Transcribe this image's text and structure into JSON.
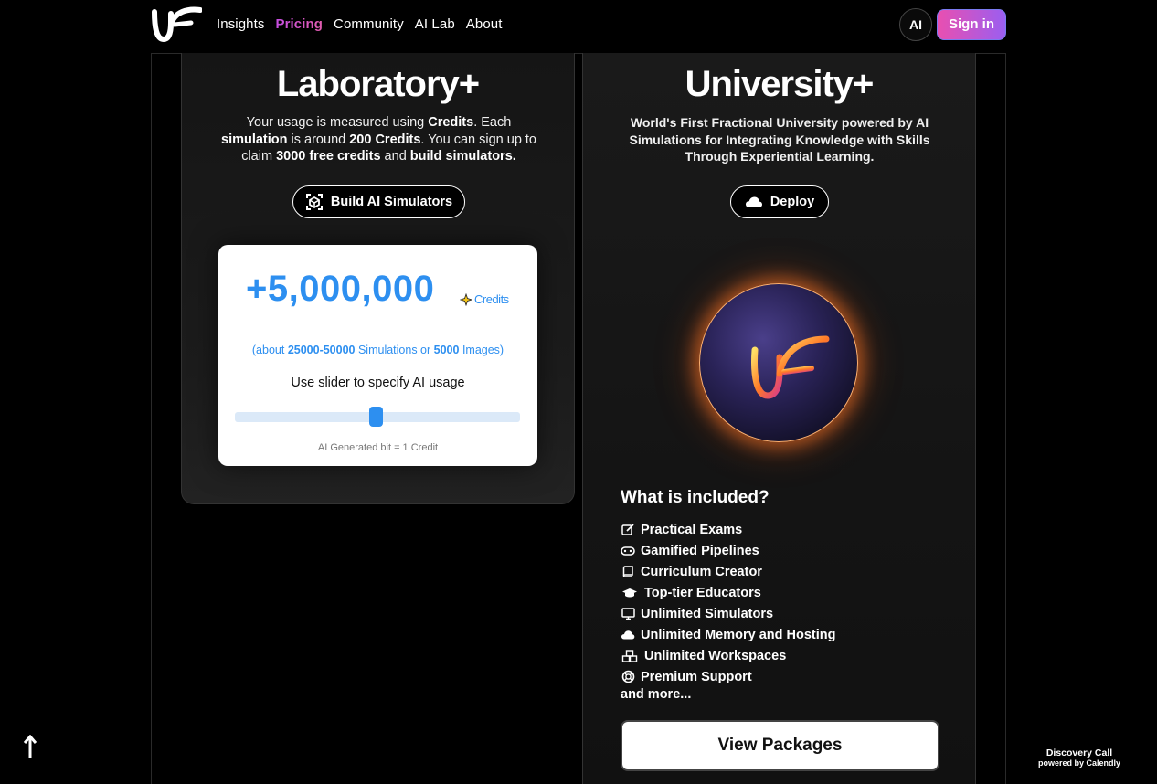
{
  "nav": {
    "links": [
      "Insights",
      "Pricing",
      "Community",
      "AI Lab",
      "About"
    ],
    "active": "Pricing",
    "ai_label": "AI",
    "signin_label": "Sign in"
  },
  "laboratory": {
    "title": "Laboratory+",
    "desc": {
      "p1": "Your usage is measured using ",
      "b1": "Credits",
      "p2": ". Each ",
      "b2": "simulation",
      "p3": " is around ",
      "b3": "200 Credits",
      "p4": ". You can sign up to claim ",
      "b4": "3000 free credits",
      "p5": " and ",
      "b5": "build simulators."
    },
    "button_label": "Build AI Simulators",
    "credits": {
      "amount": "+5,000,000",
      "unit": "Credits",
      "sub_p1": "(about ",
      "sub_b1": "25000-50000",
      "sub_p2": " Simulations or ",
      "sub_b2": "5000",
      "sub_p3": " Images)",
      "slider_label": "Use slider to specify AI usage",
      "slider_value": 0.5,
      "note": "AI Generated bit = 1 Credit"
    }
  },
  "university": {
    "title": "University+",
    "desc": "World's First Fractional University powered by AI Simulations for Integrating Knowledge with Skills Through Experiential Learning.",
    "button_label": "Deploy",
    "included_title": "What is included?",
    "included": [
      {
        "icon": "edit-icon",
        "label": "Practical Exams"
      },
      {
        "icon": "gamepad-icon",
        "label": "Gamified Pipelines"
      },
      {
        "icon": "book-icon",
        "label": "Curriculum Creator"
      },
      {
        "icon": "graduation-cap-icon",
        "label": "Top-tier Educators"
      },
      {
        "icon": "monitor-icon",
        "label": "Unlimited Simulators"
      },
      {
        "icon": "cloud-icon",
        "label": "Unlimited Memory and Hosting"
      },
      {
        "icon": "cubes-icon",
        "label": "Unlimited Workspaces"
      },
      {
        "icon": "lifebuoy-icon",
        "label": "Premium Support"
      }
    ],
    "and_more": "and more...",
    "view_label": "View Packages"
  },
  "calendly": {
    "line1": "Discovery Call",
    "line2": "powered by Calendly"
  },
  "colors": {
    "accent_blue": "#2d8ff0",
    "signin_gradient_start": "#e94fb0",
    "signin_gradient_end": "#9b5ef0",
    "orb_glow": "#ff7a28"
  }
}
